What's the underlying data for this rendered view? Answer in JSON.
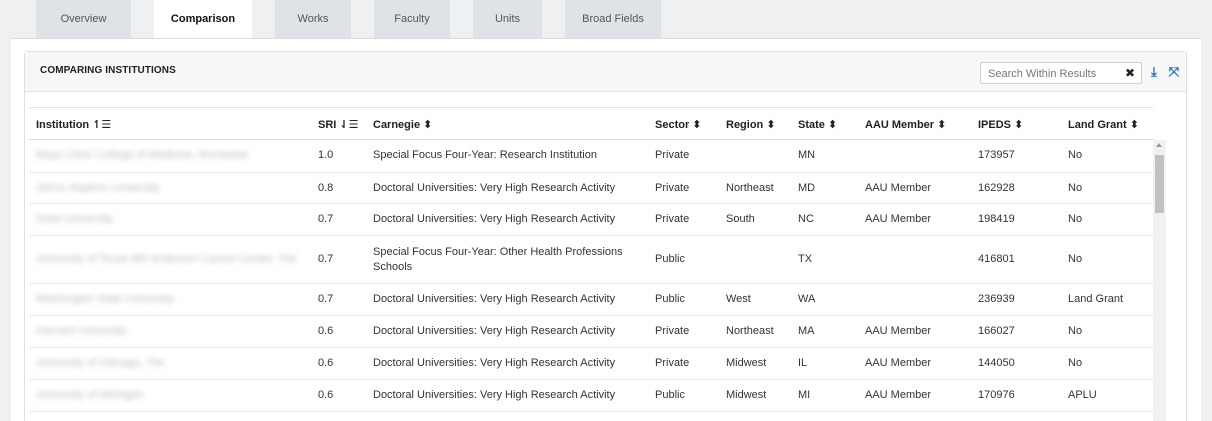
{
  "tabs": [
    {
      "label": "Overview"
    },
    {
      "label": "Comparison"
    },
    {
      "label": "Works"
    },
    {
      "label": "Faculty"
    },
    {
      "label": "Units"
    },
    {
      "label": "Broad Fields"
    }
  ],
  "panel": {
    "title": "COMPARING INSTITUTIONS",
    "search_placeholder": "Search Within Results",
    "clear_glyph": "✖",
    "download_glyph": "⤓",
    "expand_glyph": "⤧"
  },
  "columns": {
    "institution": "Institution ↿☰",
    "sri": "SRI ⇃☰",
    "carnegie": "Carnegie ⬍",
    "sector": "Sector ⬍",
    "region": "Region ⬍",
    "state": "State ⬍",
    "aau": "AAU Member ⬍",
    "ipeds": "IPEDS ⬍",
    "land_grant": "Land Grant ⬍"
  },
  "rows": [
    {
      "institution": "Mayo Clinic College of Medicine, Rochester",
      "sri": "1.0",
      "carnegie": "Special Focus Four-Year: Research Institution",
      "sector": "Private",
      "region": "",
      "state": "MN",
      "aau": "",
      "ipeds": "173957",
      "land_grant": "No"
    },
    {
      "institution": "Johns Hopkins University",
      "sri": "0.8",
      "carnegie": "Doctoral Universities: Very High Research Activity",
      "sector": "Private",
      "region": "Northeast",
      "state": "MD",
      "aau": "AAU Member",
      "ipeds": "162928",
      "land_grant": "No"
    },
    {
      "institution": "Duke University",
      "sri": "0.7",
      "carnegie": "Doctoral Universities: Very High Research Activity",
      "sector": "Private",
      "region": "South",
      "state": "NC",
      "aau": "AAU Member",
      "ipeds": "198419",
      "land_grant": "No"
    },
    {
      "institution": "University of Texas MD Anderson Cancer Center, The",
      "sri": "0.7",
      "carnegie": "Special Focus Four-Year: Other Health Professions Schools",
      "sector": "Public",
      "region": "",
      "state": "TX",
      "aau": "",
      "ipeds": "416801",
      "land_grant": "No"
    },
    {
      "institution": "Washington State University",
      "sri": "0.7",
      "carnegie": "Doctoral Universities: Very High Research Activity",
      "sector": "Public",
      "region": "West",
      "state": "WA",
      "aau": "",
      "ipeds": "236939",
      "land_grant": "Land Grant"
    },
    {
      "institution": "Harvard University",
      "sri": "0.6",
      "carnegie": "Doctoral Universities: Very High Research Activity",
      "sector": "Private",
      "region": "Northeast",
      "state": "MA",
      "aau": "AAU Member",
      "ipeds": "166027",
      "land_grant": "No"
    },
    {
      "institution": "University of Chicago, The",
      "sri": "0.6",
      "carnegie": "Doctoral Universities: Very High Research Activity",
      "sector": "Private",
      "region": "Midwest",
      "state": "IL",
      "aau": "AAU Member",
      "ipeds": "144050",
      "land_grant": "No"
    },
    {
      "institution": "University of Michigan",
      "sri": "0.6",
      "carnegie": "Doctoral Universities: Very High Research Activity",
      "sector": "Public",
      "region": "Midwest",
      "state": "MI",
      "aau": "AAU Member",
      "ipeds": "170976",
      "land_grant": "APLU"
    }
  ]
}
